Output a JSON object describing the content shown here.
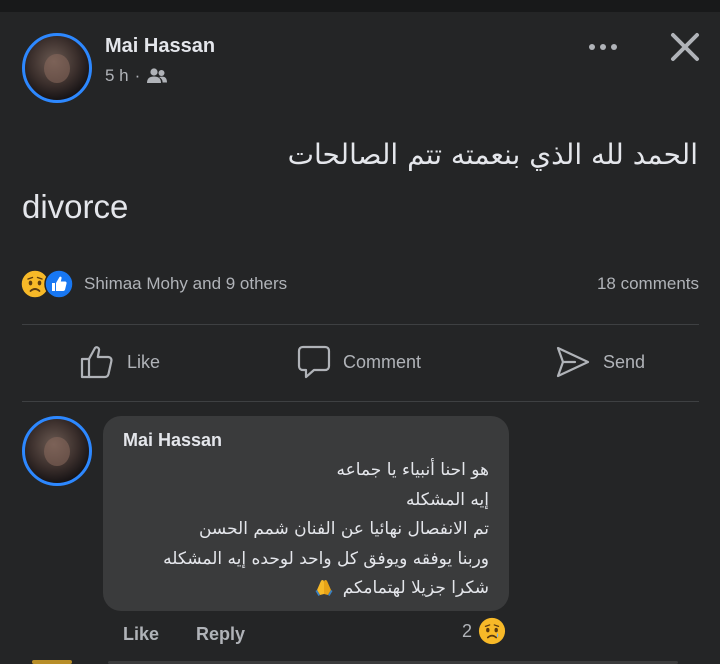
{
  "post": {
    "author": "Mai Hassan",
    "time": "5 h",
    "separator": "·",
    "audience_icon": "friends-icon",
    "text_arabic": "الحمد لله الذي بنعمته تتم الصالحات",
    "text_english": "divorce",
    "reactions_label": "Shimaa Mohy and 9 others",
    "reaction_types": [
      "sad",
      "like"
    ],
    "comments_count": "18 comments"
  },
  "actions": {
    "like": "Like",
    "comment": "Comment",
    "send": "Send"
  },
  "comment": {
    "author": "Mai Hassan",
    "lines": [
      "هو احنا أنبياء يا جماعه",
      "إيه المشكله",
      "تم الانفصال نهائيا عن الفنان شمم الحسن",
      "وربنا يوفقه ويوفق كل واحد لوحده إيه المشكله",
      "شكرا جزيلا لهتمامكم"
    ],
    "emoji_icon": "folded-hands-icon",
    "like_label": "Like",
    "reply_label": "Reply",
    "reaction_count": "2",
    "reaction_type": "sad"
  },
  "colors": {
    "background": "#242526",
    "bubble": "#3a3b3c",
    "text_primary": "#e4e6eb",
    "text_secondary": "#b0b3b8",
    "avatar_ring": "#2d88ff",
    "like_blue": "#1877f2",
    "sad_yellow": "#f7b928"
  }
}
